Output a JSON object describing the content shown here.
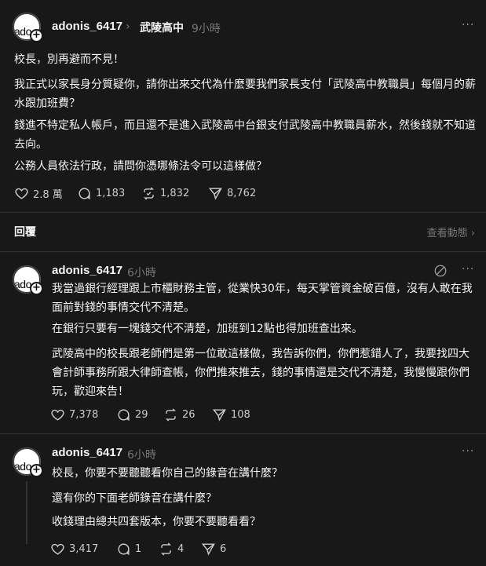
{
  "main_post": {
    "username": "adonis_6417",
    "group": "武陵高中",
    "time": "9小時",
    "avatar_alt": "ado",
    "paragraphs": [
      "校長，別再避而不見！",
      "我正式以家長身分質疑你，請你出來交代為什麼要我們家長支付「武陵高中教職員」每個月的薪水跟加班費？",
      "錢進不特定私人帳戶，而且還不是進入武陵高中台銀支付武陵高中教職員薪水，然後錢就不知道去向。",
      "公務人員依法行政，請問你憑哪條法令可以這樣做？"
    ],
    "likes": "2.8 萬",
    "comments": "1,183",
    "reposts": "1,832",
    "shares": "8,762"
  },
  "replies_bar": {
    "label": "回覆",
    "activity": "查看動態 ›"
  },
  "reply1": {
    "username": "adonis_6417",
    "time": "6小時",
    "avatar_alt": "ado",
    "paragraphs": [
      "我當過銀行經理跟上市櫃財務主管，從業快30年，每天掌管資金破百億，沒有人敢在我面前對錢的事情交代不清楚。",
      "在銀行只要有一塊錢交代不清楚，加班到12點也得加班查出來。",
      "武陵高中的校長跟老師們是第一位敢這樣做，我告訴你們，你們惹錯人了，我要找四大會計師事務所跟大律師查帳，你們推來推去，錢的事情還是交代不清楚，我慢慢跟你們玩，歡迎來告！"
    ],
    "likes": "7,378",
    "comments": "29",
    "reposts": "26",
    "shares": "108"
  },
  "reply2": {
    "username": "adonis_6417",
    "time": "6小時",
    "avatar_alt": "ado",
    "paragraphs": [
      "校長，你要不要聽聽看你自己的錄音在講什麼？",
      "還有你的下面老師錄音在講什麼？",
      "收錢理由總共四套版本，你要不要聽看看？"
    ],
    "likes": "3,417",
    "comments": "1",
    "reposts": "4",
    "shares": "6"
  },
  "icons": {
    "like": "heart-icon",
    "comment": "comment-icon",
    "repost": "repost-icon",
    "share": "share-icon",
    "more": "more-icon",
    "translate": "translate-icon"
  }
}
